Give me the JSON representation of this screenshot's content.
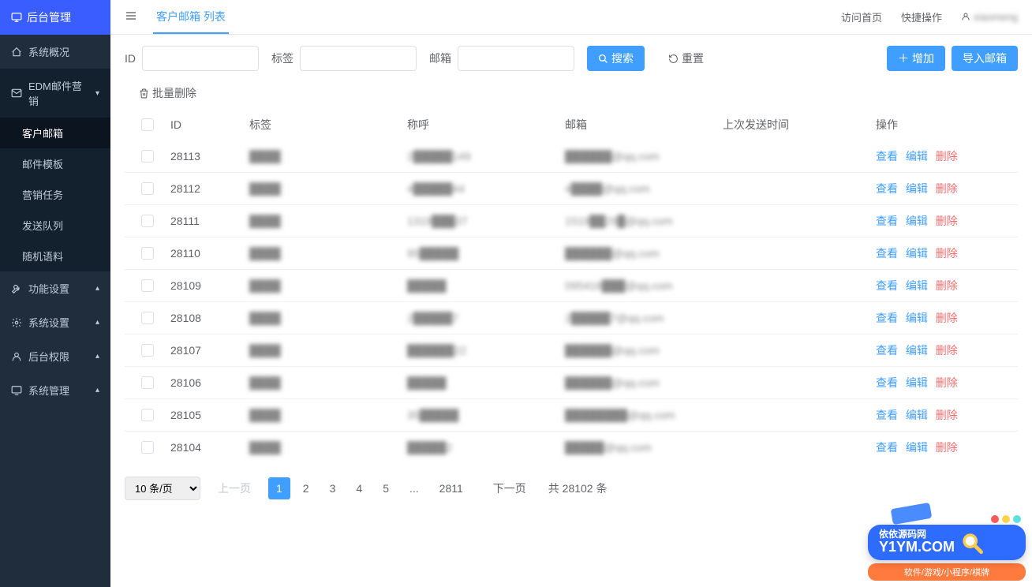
{
  "brand": "后台管理",
  "tab": "客户邮箱 列表",
  "topright": {
    "home": "访问首页",
    "quick": "快捷操作",
    "user": "xiaomeng"
  },
  "sidebar": {
    "items": [
      {
        "label": "系统概况",
        "icon": "home-icon",
        "arrow": ""
      },
      {
        "label": "EDM邮件营销",
        "icon": "mail-icon",
        "arrow": "▾",
        "active": true,
        "children": [
          {
            "label": "客户邮箱",
            "current": true
          },
          {
            "label": "邮件模板"
          },
          {
            "label": "营销任务"
          },
          {
            "label": "发送队列"
          },
          {
            "label": "随机语料"
          }
        ]
      },
      {
        "label": "功能设置",
        "icon": "wrench-icon",
        "arrow": "▴"
      },
      {
        "label": "系统设置",
        "icon": "gear-icon",
        "arrow": "▴"
      },
      {
        "label": "后台权限",
        "icon": "user-icon",
        "arrow": "▴"
      },
      {
        "label": "系统管理",
        "icon": "monitor-icon",
        "arrow": "▴"
      }
    ]
  },
  "filters": {
    "id_label": "ID",
    "tag_label": "标签",
    "email_label": "邮箱",
    "search": "搜索",
    "reset": "重置",
    "add": "增加",
    "import": "导入邮箱"
  },
  "batch_delete": "批量删除",
  "table": {
    "headers": {
      "id": "ID",
      "tag": "标签",
      "name": "称呼",
      "email": "邮箱",
      "time": "上次发送时间",
      "ops": "操作"
    },
    "ops": {
      "view": "查看",
      "edit": "编辑",
      "del": "删除"
    },
    "rows": [
      {
        "id": "28113",
        "tag": "████",
        "name": "2█████149",
        "email": "██████@qq.com",
        "time": ""
      },
      {
        "id": "28112",
        "tag": "████",
        "name": "4█████44",
        "email": "4████@qq.com",
        "time": ""
      },
      {
        "id": "28111",
        "tag": "████",
        "name": "1319███37",
        "email": "1519██29█@qq.com",
        "time": ""
      },
      {
        "id": "28110",
        "tag": "████",
        "name": "95█████",
        "email": "██████@qq.com",
        "time": ""
      },
      {
        "id": "28109",
        "tag": "████",
        "name": "█████",
        "email": "095418███@qq.com",
        "time": ""
      },
      {
        "id": "28108",
        "tag": "████",
        "name": "2█████7",
        "email": "2█████7@qq.com",
        "time": ""
      },
      {
        "id": "28107",
        "tag": "████",
        "name": "██████22",
        "email": "██████@qq.com",
        "time": ""
      },
      {
        "id": "28106",
        "tag": "████",
        "name": "█████",
        "email": "██████@qq.com",
        "time": ""
      },
      {
        "id": "28105",
        "tag": "████",
        "name": "35█████",
        "email": "████████@qq.com",
        "time": ""
      },
      {
        "id": "28104",
        "tag": "████",
        "name": "█████2",
        "email": "█████@qq.com",
        "time": ""
      }
    ]
  },
  "pagination": {
    "size": "10 条/页",
    "prev": "上一页",
    "next": "下一页",
    "pages": [
      "1",
      "2",
      "3",
      "4",
      "5",
      "...",
      "2811"
    ],
    "total": "共 28102 条"
  },
  "corner": {
    "title": "依依源码网",
    "domain": "Y1YM.COM",
    "sub": "软件/游戏/小程序/棋牌"
  }
}
